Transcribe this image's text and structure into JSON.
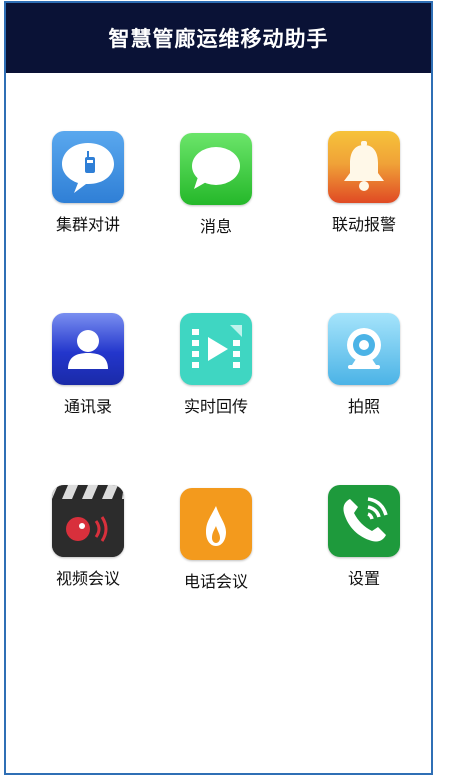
{
  "header": {
    "title": "智慧管廊运维移动助手"
  },
  "apps": [
    {
      "label": "集群对讲",
      "icon": "intercom-bubble-icon",
      "color": "#3d8fe0"
    },
    {
      "label": "消息",
      "icon": "message-bubble-icon",
      "color": "#3fcf3c"
    },
    {
      "label": "联动报警",
      "icon": "alarm-bell-icon",
      "color": "#e8502a"
    },
    {
      "label": "通讯录",
      "icon": "contacts-person-icon",
      "color": "#2b3fd0"
    },
    {
      "label": "实时回传",
      "icon": "video-play-icon",
      "color": "#3fd6c2"
    },
    {
      "label": "拍照",
      "icon": "camera-lens-icon",
      "color": "#5cc4ec"
    },
    {
      "label": "视频会议",
      "icon": "clapperboard-icon",
      "color": "#2a2a2a"
    },
    {
      "label": "电话会议",
      "icon": "flame-icon",
      "color": "#f39a1d"
    },
    {
      "label": "设置",
      "icon": "phone-call-icon",
      "color": "#1e9a3c"
    }
  ]
}
